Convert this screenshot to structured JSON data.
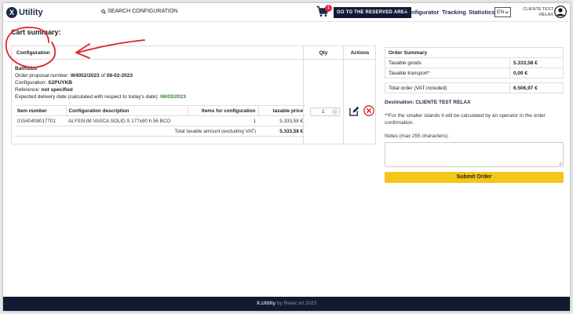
{
  "header": {
    "logo_mark": "X",
    "logo_text": "Utility",
    "search_label": "SEARCH CONFIGURATION",
    "cart_count": "1",
    "reserved_button": "GO TO THE RESERVED AREA",
    "nav": [
      "Configurator",
      "Tracking",
      "Statistics"
    ],
    "language": "EN",
    "user_line1": "CLIENTE TEST",
    "user_line2": "RELAX",
    "icons": [
      "search-icon",
      "cart-icon",
      "chevron-down-icon",
      "user-avatar-icon"
    ]
  },
  "page_title": "Cart summary:",
  "cart": {
    "columns": {
      "configuration": "Configuration",
      "qty": "Qty",
      "actions": "Actions"
    },
    "category": "Bathtubs",
    "proposal_label": "Order proposal number: ",
    "proposal_number": "W4052/2023",
    "proposal_of": " of ",
    "proposal_date": "08-02-2023",
    "configuration_label": "Configuration: ",
    "configuration_code": "S2PUYKB",
    "reference_label": "Reference: ",
    "reference_value": "not specified",
    "delivery_label": "Expected delivery date (calculated with respect to today's date): ",
    "delivery_date": "06/03/2023",
    "item_headers": [
      "Item number",
      "Configuration description",
      "Items for configuration",
      "taxable price"
    ],
    "items": [
      {
        "item_number": "01540408017701",
        "description": "ALYSSUM VASCA SOLID.S 177x80 h.56 BCO",
        "qty_per_config": "1",
        "price": "5.333,58 €"
      }
    ],
    "total_label": "Total taxable amount (excluding VAT)",
    "total_value": "5.333,58 €",
    "quantity": "1",
    "action_icons": [
      "edit-icon",
      "remove-icon"
    ]
  },
  "order_summary": {
    "title": "Order Summary",
    "taxable_goods_label": "Taxable goods",
    "taxable_goods_value": "5.333,58 €",
    "transport_label": "Taxable transport*",
    "transport_value": "0,00 €",
    "total_label": "Total order (VAT included)",
    "total_value": "6.506,97 €"
  },
  "destination": "Destination: CLIENTE TEST RELAX",
  "island_note": "**For the smaller islands it will be calculated by an operator in the order confirmation.",
  "notes_label": "Notes (max 255 characters):",
  "notes_value": "",
  "submit_label": "Submit Order",
  "footer": {
    "brand": "X.Utility",
    "text": " by Relax srl 2023"
  },
  "colors": {
    "navy": "#111a33",
    "accent_yellow": "#f5c518",
    "annotation_red": "#e0202a",
    "date_green": "#2e7d32",
    "remove_red": "#d9252d"
  }
}
